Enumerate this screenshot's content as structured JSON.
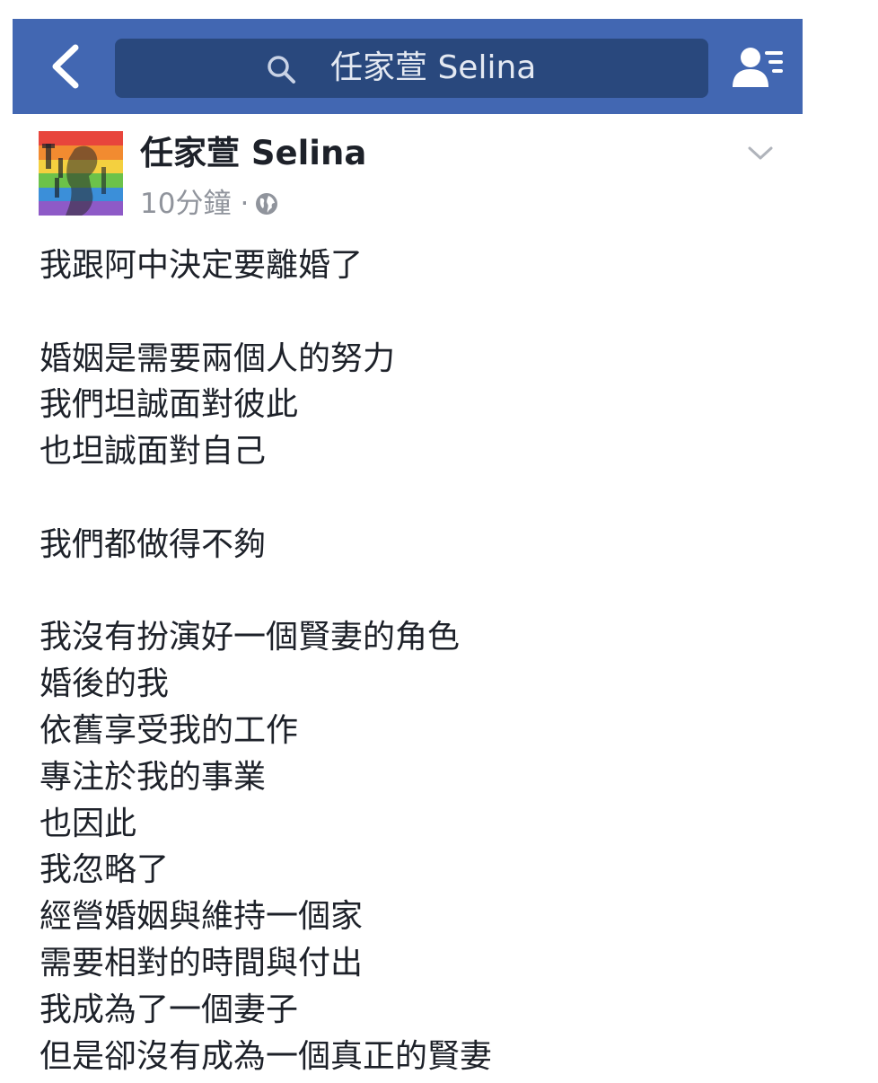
{
  "nav": {
    "search_text": "任家萱 Selina"
  },
  "post": {
    "author": "任家萱 Selina",
    "time": "10分鐘",
    "separator": "·",
    "lines": [
      "我跟阿中決定要離婚了",
      "",
      "婚姻是需要兩個人的努力",
      "我們坦誠面對彼此",
      "也坦誠面對自己",
      "",
      "我們都做得不夠",
      "",
      "我沒有扮演好一個賢妻的角色",
      "婚後的我",
      "依舊享受我的工作",
      "專注於我的事業",
      "也因此",
      "我忽略了",
      "經營婚姻與維持一個家",
      "需要相對的時間與付出",
      "我成為了一個妻子",
      "但是卻沒有成為一個真正的賢妻"
    ]
  },
  "icons": {
    "back": "chevron-left-icon",
    "search": "search-icon",
    "friends": "friend-requests-icon",
    "privacy": "globe-icon",
    "options": "chevron-down-icon"
  },
  "colors": {
    "nav_bar": "#4267b2",
    "search_box": "#29487d",
    "text": "#1d2129",
    "meta_text": "#90949c"
  }
}
